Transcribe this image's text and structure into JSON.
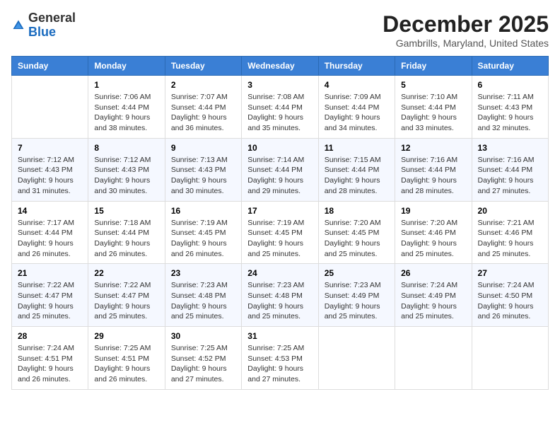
{
  "logo": {
    "general": "General",
    "blue": "Blue"
  },
  "header": {
    "month": "December 2025",
    "location": "Gambrills, Maryland, United States"
  },
  "weekdays": [
    "Sunday",
    "Monday",
    "Tuesday",
    "Wednesday",
    "Thursday",
    "Friday",
    "Saturday"
  ],
  "weeks": [
    [
      {
        "day": "",
        "sunrise": "",
        "sunset": "",
        "daylight": ""
      },
      {
        "day": "1",
        "sunrise": "Sunrise: 7:06 AM",
        "sunset": "Sunset: 4:44 PM",
        "daylight": "Daylight: 9 hours and 38 minutes."
      },
      {
        "day": "2",
        "sunrise": "Sunrise: 7:07 AM",
        "sunset": "Sunset: 4:44 PM",
        "daylight": "Daylight: 9 hours and 36 minutes."
      },
      {
        "day": "3",
        "sunrise": "Sunrise: 7:08 AM",
        "sunset": "Sunset: 4:44 PM",
        "daylight": "Daylight: 9 hours and 35 minutes."
      },
      {
        "day": "4",
        "sunrise": "Sunrise: 7:09 AM",
        "sunset": "Sunset: 4:44 PM",
        "daylight": "Daylight: 9 hours and 34 minutes."
      },
      {
        "day": "5",
        "sunrise": "Sunrise: 7:10 AM",
        "sunset": "Sunset: 4:44 PM",
        "daylight": "Daylight: 9 hours and 33 minutes."
      },
      {
        "day": "6",
        "sunrise": "Sunrise: 7:11 AM",
        "sunset": "Sunset: 4:43 PM",
        "daylight": "Daylight: 9 hours and 32 minutes."
      }
    ],
    [
      {
        "day": "7",
        "sunrise": "Sunrise: 7:12 AM",
        "sunset": "Sunset: 4:43 PM",
        "daylight": "Daylight: 9 hours and 31 minutes."
      },
      {
        "day": "8",
        "sunrise": "Sunrise: 7:12 AM",
        "sunset": "Sunset: 4:43 PM",
        "daylight": "Daylight: 9 hours and 30 minutes."
      },
      {
        "day": "9",
        "sunrise": "Sunrise: 7:13 AM",
        "sunset": "Sunset: 4:43 PM",
        "daylight": "Daylight: 9 hours and 30 minutes."
      },
      {
        "day": "10",
        "sunrise": "Sunrise: 7:14 AM",
        "sunset": "Sunset: 4:44 PM",
        "daylight": "Daylight: 9 hours and 29 minutes."
      },
      {
        "day": "11",
        "sunrise": "Sunrise: 7:15 AM",
        "sunset": "Sunset: 4:44 PM",
        "daylight": "Daylight: 9 hours and 28 minutes."
      },
      {
        "day": "12",
        "sunrise": "Sunrise: 7:16 AM",
        "sunset": "Sunset: 4:44 PM",
        "daylight": "Daylight: 9 hours and 28 minutes."
      },
      {
        "day": "13",
        "sunrise": "Sunrise: 7:16 AM",
        "sunset": "Sunset: 4:44 PM",
        "daylight": "Daylight: 9 hours and 27 minutes."
      }
    ],
    [
      {
        "day": "14",
        "sunrise": "Sunrise: 7:17 AM",
        "sunset": "Sunset: 4:44 PM",
        "daylight": "Daylight: 9 hours and 26 minutes."
      },
      {
        "day": "15",
        "sunrise": "Sunrise: 7:18 AM",
        "sunset": "Sunset: 4:44 PM",
        "daylight": "Daylight: 9 hours and 26 minutes."
      },
      {
        "day": "16",
        "sunrise": "Sunrise: 7:19 AM",
        "sunset": "Sunset: 4:45 PM",
        "daylight": "Daylight: 9 hours and 26 minutes."
      },
      {
        "day": "17",
        "sunrise": "Sunrise: 7:19 AM",
        "sunset": "Sunset: 4:45 PM",
        "daylight": "Daylight: 9 hours and 25 minutes."
      },
      {
        "day": "18",
        "sunrise": "Sunrise: 7:20 AM",
        "sunset": "Sunset: 4:45 PM",
        "daylight": "Daylight: 9 hours and 25 minutes."
      },
      {
        "day": "19",
        "sunrise": "Sunrise: 7:20 AM",
        "sunset": "Sunset: 4:46 PM",
        "daylight": "Daylight: 9 hours and 25 minutes."
      },
      {
        "day": "20",
        "sunrise": "Sunrise: 7:21 AM",
        "sunset": "Sunset: 4:46 PM",
        "daylight": "Daylight: 9 hours and 25 minutes."
      }
    ],
    [
      {
        "day": "21",
        "sunrise": "Sunrise: 7:22 AM",
        "sunset": "Sunset: 4:47 PM",
        "daylight": "Daylight: 9 hours and 25 minutes."
      },
      {
        "day": "22",
        "sunrise": "Sunrise: 7:22 AM",
        "sunset": "Sunset: 4:47 PM",
        "daylight": "Daylight: 9 hours and 25 minutes."
      },
      {
        "day": "23",
        "sunrise": "Sunrise: 7:23 AM",
        "sunset": "Sunset: 4:48 PM",
        "daylight": "Daylight: 9 hours and 25 minutes."
      },
      {
        "day": "24",
        "sunrise": "Sunrise: 7:23 AM",
        "sunset": "Sunset: 4:48 PM",
        "daylight": "Daylight: 9 hours and 25 minutes."
      },
      {
        "day": "25",
        "sunrise": "Sunrise: 7:23 AM",
        "sunset": "Sunset: 4:49 PM",
        "daylight": "Daylight: 9 hours and 25 minutes."
      },
      {
        "day": "26",
        "sunrise": "Sunrise: 7:24 AM",
        "sunset": "Sunset: 4:49 PM",
        "daylight": "Daylight: 9 hours and 25 minutes."
      },
      {
        "day": "27",
        "sunrise": "Sunrise: 7:24 AM",
        "sunset": "Sunset: 4:50 PM",
        "daylight": "Daylight: 9 hours and 26 minutes."
      }
    ],
    [
      {
        "day": "28",
        "sunrise": "Sunrise: 7:24 AM",
        "sunset": "Sunset: 4:51 PM",
        "daylight": "Daylight: 9 hours and 26 minutes."
      },
      {
        "day": "29",
        "sunrise": "Sunrise: 7:25 AM",
        "sunset": "Sunset: 4:51 PM",
        "daylight": "Daylight: 9 hours and 26 minutes."
      },
      {
        "day": "30",
        "sunrise": "Sunrise: 7:25 AM",
        "sunset": "Sunset: 4:52 PM",
        "daylight": "Daylight: 9 hours and 27 minutes."
      },
      {
        "day": "31",
        "sunrise": "Sunrise: 7:25 AM",
        "sunset": "Sunset: 4:53 PM",
        "daylight": "Daylight: 9 hours and 27 minutes."
      },
      {
        "day": "",
        "sunrise": "",
        "sunset": "",
        "daylight": ""
      },
      {
        "day": "",
        "sunrise": "",
        "sunset": "",
        "daylight": ""
      },
      {
        "day": "",
        "sunrise": "",
        "sunset": "",
        "daylight": ""
      }
    ]
  ]
}
